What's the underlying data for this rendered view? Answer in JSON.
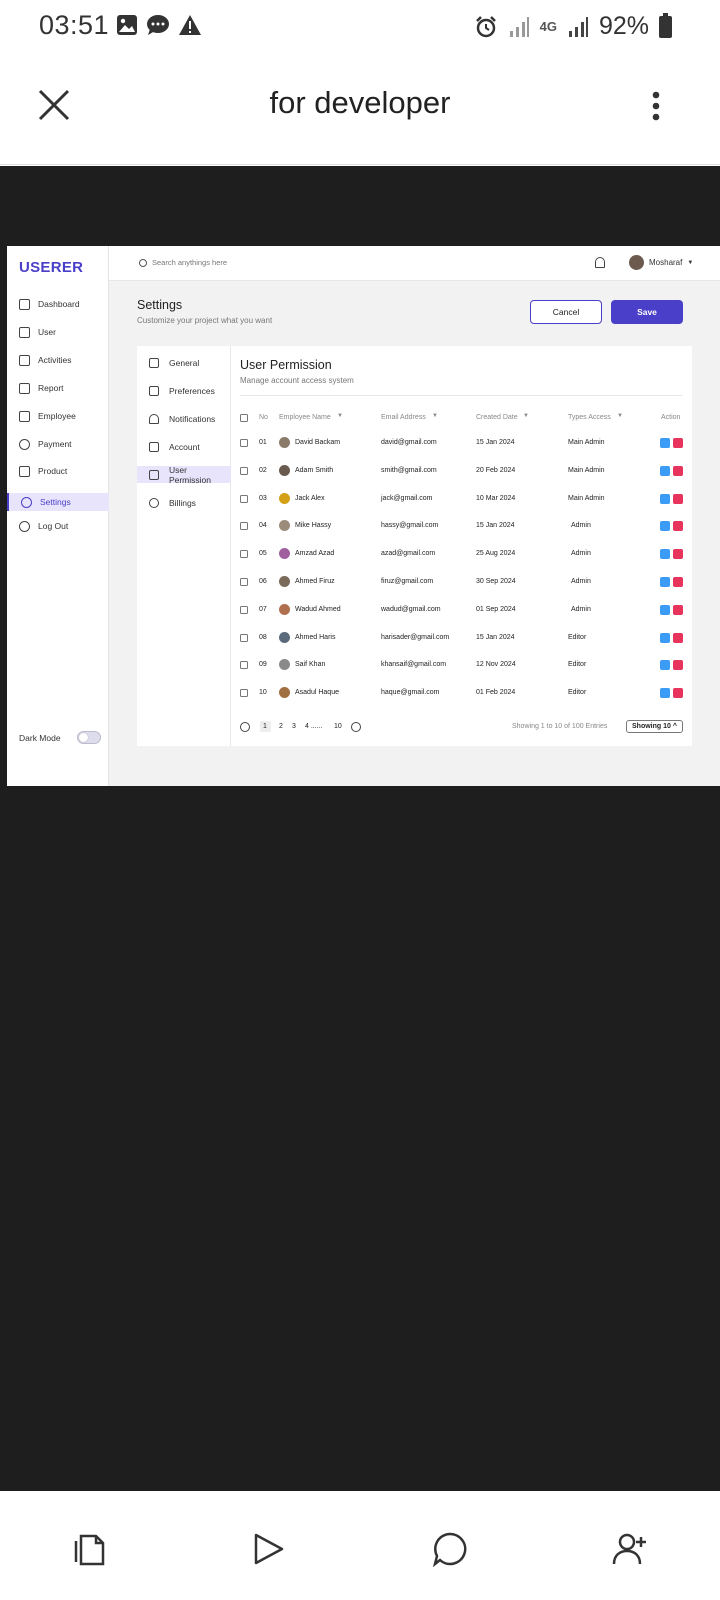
{
  "status_bar": {
    "time": "03:51",
    "network": "4G",
    "battery": "92%"
  },
  "app_bar": {
    "title": "for developer"
  },
  "dashboard": {
    "logo": "USERER",
    "nav": [
      {
        "label": "Dashboard",
        "icon": "grid-icon"
      },
      {
        "label": "User",
        "icon": "users-icon"
      },
      {
        "label": "Activities",
        "icon": "activity-icon"
      },
      {
        "label": "Report",
        "icon": "flag-icon"
      },
      {
        "label": "Employee",
        "icon": "people-icon"
      },
      {
        "label": "Payment",
        "icon": "dollar-icon"
      },
      {
        "label": "Product",
        "icon": "box-icon"
      },
      {
        "label": "Settings",
        "icon": "gear-icon",
        "active": true
      },
      {
        "label": "Log Out",
        "icon": "logout-icon"
      }
    ],
    "dark_mode_label": "Dark Mode",
    "search_placeholder": "Search anythings here",
    "user_name": "Mosharaf",
    "settings_title": "Settings",
    "settings_subtitle": "Customize your project what you want",
    "cancel_label": "Cancel",
    "save_label": "Save",
    "settings_menu": [
      {
        "label": "General",
        "icon": "home-icon"
      },
      {
        "label": "Preferences",
        "icon": "preferences-icon"
      },
      {
        "label": "Notifications",
        "icon": "bell-icon"
      },
      {
        "label": "Account",
        "icon": "account-icon"
      },
      {
        "label": "User Permission",
        "icon": "users-icon",
        "active": true
      },
      {
        "label": "Billings",
        "icon": "dollar-icon"
      }
    ],
    "panel_title": "User Permission",
    "panel_subtitle": "Manage account access system",
    "columns": {
      "no": "No",
      "name": "Employee Name",
      "email": "Email Address",
      "created": "Created Date",
      "type": "Types Access",
      "action": "Action"
    },
    "rows": [
      {
        "no": "01",
        "name": "David Backam",
        "email": "david@gmail.com",
        "date": "15 Jan 2024",
        "access": "Main Admin"
      },
      {
        "no": "02",
        "name": "Adam Smith",
        "email": "smith@gmail.com",
        "date": "20 Feb 2024",
        "access": "Main Admin"
      },
      {
        "no": "03",
        "name": "Jack Alex",
        "email": "jack@gmail.com",
        "date": "10 Mar 2024",
        "access": "Main Admin"
      },
      {
        "no": "04",
        "name": "Mike Hassy",
        "email": "hassy@gmail.com",
        "date": "15 Jan 2024",
        "access": "Admin"
      },
      {
        "no": "05",
        "name": "Amzad Azad",
        "email": "azad@gmail.com",
        "date": "25 Aug 2024",
        "access": "Admin"
      },
      {
        "no": "06",
        "name": "Ahmed Firuz",
        "email": "firuz@gmail.com",
        "date": "30 Sep 2024",
        "access": "Admin"
      },
      {
        "no": "07",
        "name": "Wadud Ahmed",
        "email": "wadud@gmail.com",
        "date": "01 Sep 2024",
        "access": "Admin"
      },
      {
        "no": "08",
        "name": "Ahmed Haris",
        "email": "harisader@gmail.com",
        "date": "15 Jan 2024",
        "access": "Editor"
      },
      {
        "no": "09",
        "name": "Saif Khan",
        "email": "khansaif@gmail.com",
        "date": "12 Nov 2024",
        "access": "Editor"
      },
      {
        "no": "10",
        "name": "Asadul Haque",
        "email": "haque@gmail.com",
        "date": "01 Feb 2024",
        "access": "Editor"
      }
    ],
    "pagination": {
      "pages": [
        "1",
        "2",
        "3",
        "4 ......",
        "10"
      ],
      "current": "1"
    },
    "showing_text": "Showing 1 to 10 of 100 Entries",
    "page_size": "Showing 10"
  },
  "colors": {
    "accent": "#4a3fc9",
    "edit": "#3b9cf5",
    "delete": "#e8335c"
  }
}
